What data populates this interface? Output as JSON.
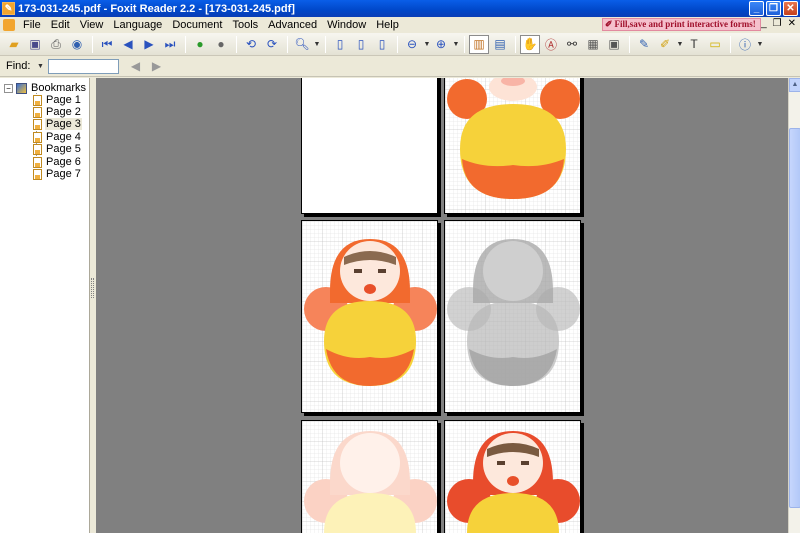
{
  "window": {
    "title": "173-031-245.pdf - Foxit Reader 2.2 - [173-031-245.pdf]"
  },
  "menu": [
    "File",
    "Edit",
    "View",
    "Language",
    "Document",
    "Tools",
    "Advanced",
    "Window",
    "Help"
  ],
  "promo": "Fill,save and print interactive forms!",
  "find": {
    "label": "Find:",
    "value": ""
  },
  "bookmarks": {
    "root": "Bookmarks",
    "items": [
      "Page 1",
      "Page 2",
      "Page 3",
      "Page 4",
      "Page 5",
      "Page 6",
      "Page 7"
    ],
    "selected": "Page 3"
  },
  "toolbar_icons": [
    "open-icon",
    "save-icon",
    "print-icon",
    "email-icon",
    "first-page-icon",
    "prev-page-icon",
    "next-page-icon",
    "last-page-icon",
    "go-back-icon",
    "go-forward-icon",
    "rotate-left-icon",
    "rotate-right-icon",
    "zoom-icon",
    "actual-size-icon",
    "fit-page-icon",
    "fit-width-icon",
    "zoom-out-icon",
    "zoom-in-icon",
    "single-page-icon",
    "continuous-icon",
    "hand-tool-icon",
    "text-select-icon",
    "find-icon",
    "snapshot-icon",
    "image-icon",
    "typewriter-icon",
    "highlight-icon",
    "text-icon",
    "note-icon",
    "info-icon"
  ],
  "colors": {
    "accent": "#0a5ee8",
    "viewer_bg": "#808080",
    "doll_orange": "#f26a2e",
    "doll_yellow": "#f6d23a",
    "doll_red": "#e84c2c"
  }
}
